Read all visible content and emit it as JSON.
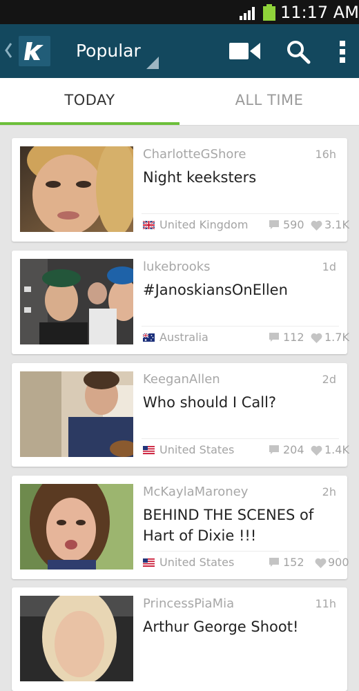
{
  "status_bar": {
    "time": "11:17 AM"
  },
  "header": {
    "title": "Popular"
  },
  "tabs": [
    {
      "label": "TODAY",
      "selected": true
    },
    {
      "label": "ALL TIME",
      "selected": false
    }
  ],
  "colors": {
    "header": "#13485e",
    "accent": "#6cbf3a",
    "status_bar": "#141414"
  },
  "feed": [
    {
      "user": "CharlotteGShore",
      "time": "16h",
      "caption": "Night keeksters",
      "country": "United Kingdom",
      "comments": "590",
      "likes": "3.1K"
    },
    {
      "user": "lukebrooks",
      "time": "1d",
      "caption": "#JanoskiansOnEllen",
      "country": "Australia",
      "comments": "112",
      "likes": "1.7K"
    },
    {
      "user": "KeeganAllen",
      "time": "2d",
      "caption": "Who should I Call?",
      "country": "United States",
      "comments": "204",
      "likes": "1.4K"
    },
    {
      "user": "McKaylaMaroney",
      "time": "2h",
      "caption": "BEHIND THE SCENES of Hart of Dixie !!!",
      "country": "United States",
      "comments": "152",
      "likes": "900"
    },
    {
      "user": "PrincessPiaMia",
      "time": "11h",
      "caption": "Arthur George Shoot!",
      "country": "",
      "comments": "",
      "likes": ""
    }
  ]
}
